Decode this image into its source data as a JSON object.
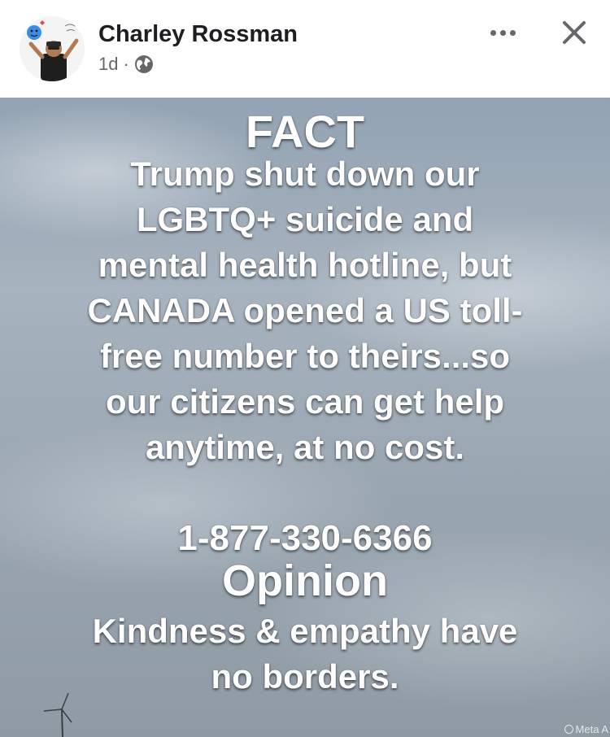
{
  "post": {
    "author": "Charley Rossman",
    "time": "1d",
    "separator": "·",
    "privacy_icon": "globe-icon",
    "more_icon": "more-dots-icon",
    "close_icon": "close-icon"
  },
  "image": {
    "fact_heading": "FACT",
    "fact_lines": [
      "Trump shut down our",
      "LGBTQ+ suicide and",
      "mental health hotline, but",
      "CANADA opened a US toll-",
      "free number to theirs...so",
      "our citizens can get help",
      "anytime, at no cost."
    ],
    "phone": "1-877-330-6366",
    "opinion_heading": "Opinion",
    "opinion_lines": [
      "Kindness & empathy have",
      "no borders."
    ],
    "watermark": "Meta A"
  }
}
